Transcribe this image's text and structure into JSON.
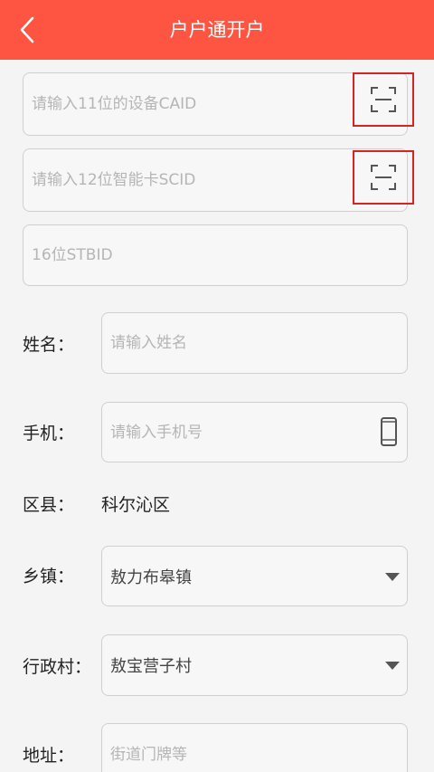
{
  "header": {
    "title": "户户通开户",
    "bg_color": "#fd5541"
  },
  "device": {
    "caid_placeholder": "请输入11位的设备CAID",
    "scid_placeholder": "请输入12位智能卡SCID",
    "stbid_placeholder": "16位STBID"
  },
  "form": {
    "name_label": "姓名：",
    "name_placeholder": "请输入姓名",
    "phone_label": "手机：",
    "phone_placeholder": "请输入手机号",
    "district_label": "区县：",
    "district_value": "科尔沁区",
    "township_label": "乡镇：",
    "township_value": "敖力布皋镇",
    "village_label": "行政村：",
    "village_value": "敖宝营子村",
    "address_label": "地址：",
    "address_placeholder": "街道门牌等"
  },
  "icons": {
    "back": "chevron-left-icon",
    "scan": "scan-frame-icon",
    "phone": "mobile-phone-icon",
    "dropdown": "caret-down-icon"
  },
  "colors": {
    "scan_highlight": "#d42424"
  }
}
